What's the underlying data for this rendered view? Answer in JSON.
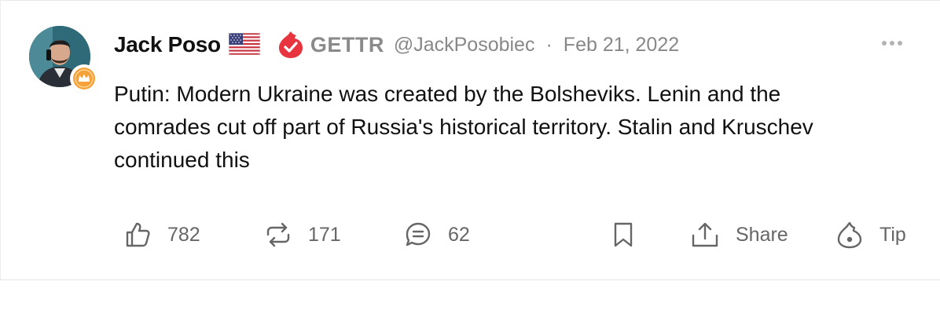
{
  "post": {
    "author_name": "Jack Poso",
    "platform_label": "GETTR",
    "handle": "@JackPosobiec",
    "separator": "·",
    "date": "Feb 21, 2022",
    "text": "Putin: Modern Ukraine was created by the Bolsheviks. Lenin and the comrades cut off part of Russia's historical territory. Stalin and Kruschev continued this"
  },
  "actions": {
    "like_count": "782",
    "repost_count": "171",
    "comment_count": "62",
    "share_label": "Share",
    "tip_label": "Tip"
  },
  "colors": {
    "verified_red": "#e8343f",
    "crown_orange": "#f5a23a",
    "muted_text": "#888888",
    "icon_gray": "#666666"
  },
  "icons": [
    "us-flag-icon",
    "gettr-verified-icon",
    "crown-icon",
    "more-icon",
    "like-icon",
    "repost-icon",
    "comment-icon",
    "bookmark-icon",
    "share-icon",
    "tip-icon"
  ]
}
